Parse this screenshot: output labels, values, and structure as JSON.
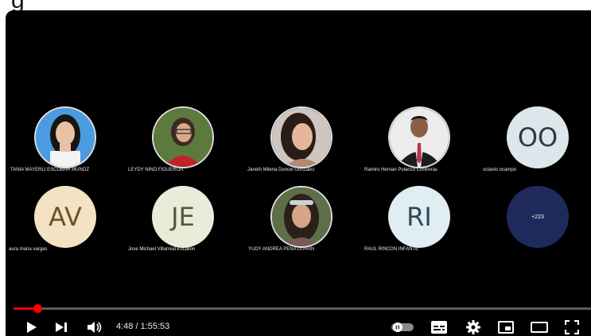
{
  "participants": [
    {
      "name": "TANIA MAYERLI ESCOBAR MUNOZ",
      "avatar_type": "photo",
      "photo": "woman-dark-hair-white-shirt"
    },
    {
      "name": "LEYDY NINO FIGUEROA",
      "avatar_type": "photo",
      "photo": "woman-glasses-red-top"
    },
    {
      "name": "Janeth Milena Doncel Gonzalez",
      "avatar_type": "photo",
      "photo": "woman-long-hair-selfie"
    },
    {
      "name": "Ramiro Hernan Polanco Contreras",
      "avatar_type": "photo",
      "photo": "man-suit-tie"
    },
    {
      "name": "octavio ocampo",
      "avatar_type": "initials",
      "initials": "OO",
      "color": "#dde6ea"
    },
    {
      "name": "aura maria vargas",
      "avatar_type": "initials",
      "initials": "AV",
      "color": "#f3e3c4"
    },
    {
      "name": "Jose Michael Villarreal Escallon",
      "avatar_type": "initials",
      "initials": "JE",
      "color": "#e9ecd9"
    },
    {
      "name": "YUDY ANDREA PENA DURAN",
      "avatar_type": "photo",
      "photo": "woman-sunglasses-on-head"
    },
    {
      "name": "RAUL RINCON INFANTE",
      "avatar_type": "initials",
      "initials": "RI",
      "color": "#e0edf2"
    }
  ],
  "extra_participants": "+223",
  "player": {
    "current_time": "4:48",
    "duration": "1:55:53",
    "time_display": "4:48 / 1:55:53",
    "progress_fraction": 0.0414,
    "progress_color": "#ff0000"
  },
  "controls": {
    "play": "play-icon",
    "next": "next-icon",
    "volume": "volume-icon",
    "autoplay": "autoplay-toggle-icon",
    "subtitles": "subtitles-icon",
    "settings": "settings-icon",
    "miniplayer": "miniplayer-icon",
    "theater": "theater-mode-icon",
    "fullscreen": "fullscreen-icon"
  }
}
